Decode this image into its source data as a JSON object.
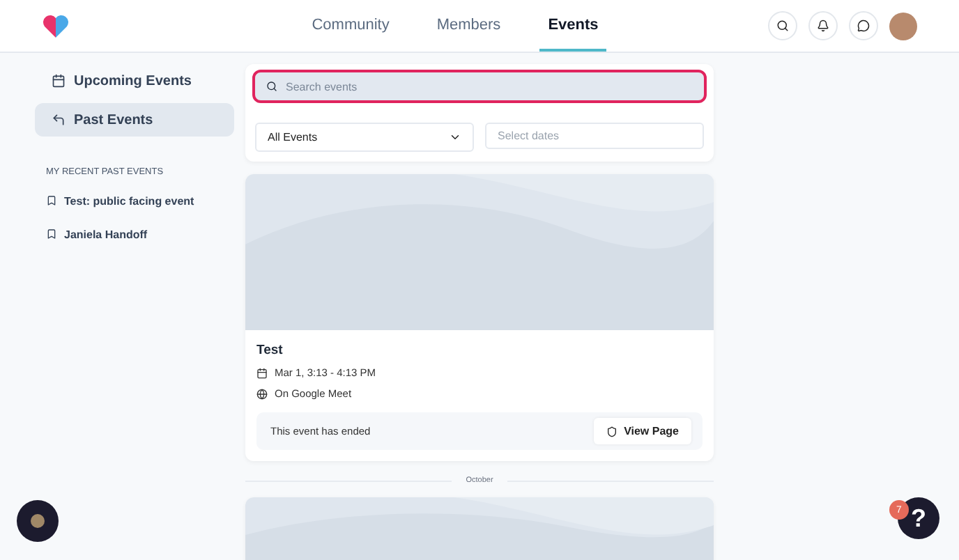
{
  "nav": {
    "tabs": [
      {
        "label": "Community",
        "selected": false
      },
      {
        "label": "Members",
        "selected": false
      },
      {
        "label": "Events",
        "selected": true
      }
    ]
  },
  "sidebar": {
    "items": [
      {
        "label": "Upcoming Events",
        "kind": "calendar",
        "selected": false
      },
      {
        "label": "Past Events",
        "kind": "back",
        "selected": true
      }
    ],
    "section_title": "MY RECENT PAST EVENTS",
    "recent": [
      "Test: public facing event",
      "Janiela Handoff"
    ]
  },
  "search": {
    "placeholder": "Search events",
    "highlighted": true
  },
  "filter": {
    "value": "All Events"
  },
  "dates": {
    "placeholder": "Select dates"
  },
  "events": [
    {
      "title": "Test",
      "time": "Mar 1, 3:13 - 4:13 PM",
      "location": "On Google Meet",
      "status": "This event has ended",
      "button": "View Page"
    }
  ],
  "divider": "October",
  "help": {
    "label": "?",
    "badge": "7"
  }
}
